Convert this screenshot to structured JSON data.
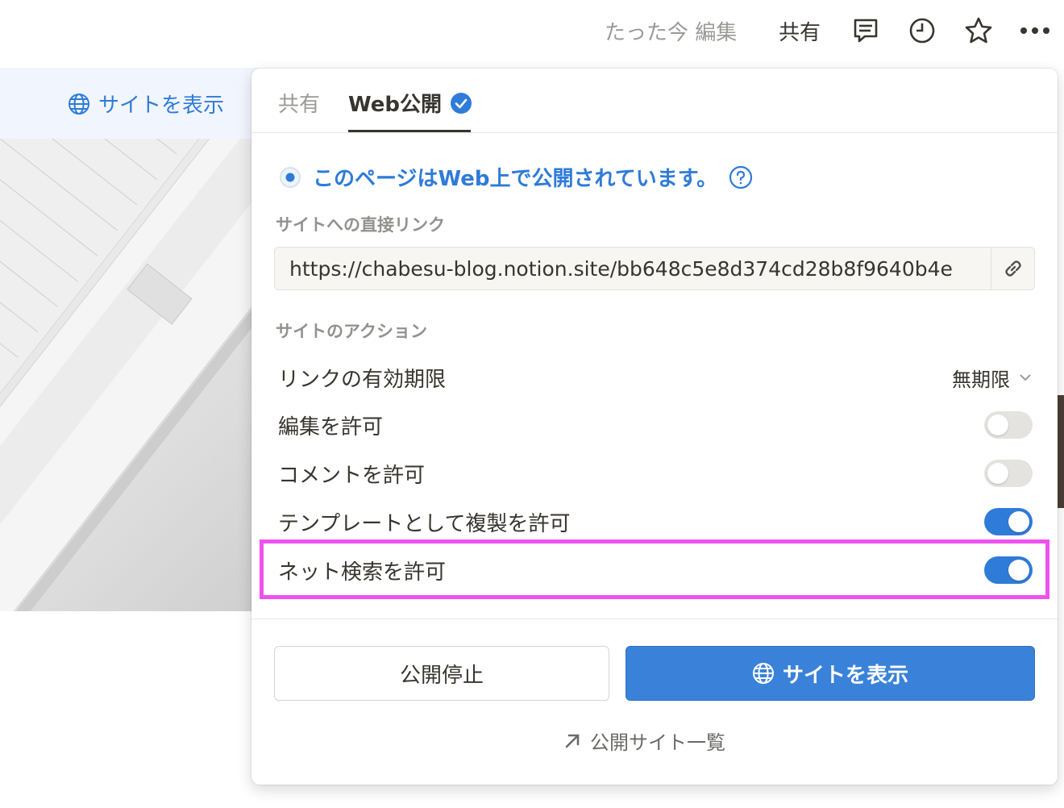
{
  "topbar": {
    "edited_label": "たった今 編集",
    "share_label": "共有",
    "icons": [
      "comment-icon",
      "clock-icon",
      "star-icon",
      "more-icon"
    ]
  },
  "background": {
    "site_link_label": "サイトを表示"
  },
  "popup": {
    "tabs": {
      "share": "共有",
      "web_publish": "Web公開"
    },
    "published_message": "このページはWeb上で公開されています。",
    "direct_link_label": "サイトへの直接リンク",
    "url": "https://chabesu-blog.notion.site/bb648c5e8d374cd28b8f9640b4e",
    "actions_label": "サイトのアクション",
    "rows": {
      "link_expiry": {
        "label": "リンクの有効期限",
        "value": "無期限"
      },
      "allow_edit": {
        "label": "編集を許可",
        "on": false
      },
      "allow_comment": {
        "label": "コメントを許可",
        "on": false
      },
      "allow_duplicate": {
        "label": "テンプレートとして複製を許可",
        "on": true
      },
      "allow_search": {
        "label": "ネット検索を許可",
        "on": true
      }
    },
    "unpublish_label": "公開停止",
    "view_site_label": "サイトを表示",
    "all_sites_label": "公開サイト一覧"
  },
  "colors": {
    "accent": "#2f7bd8",
    "highlight": "#ee52ee"
  }
}
